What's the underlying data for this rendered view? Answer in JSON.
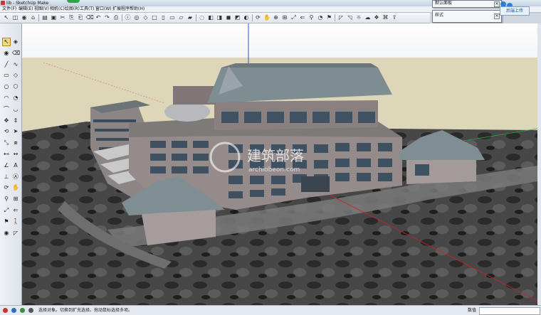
{
  "window": {
    "title": "lib - SketchUp Make",
    "menu": [
      "文件(F)",
      "编辑(E)",
      "视图(V)",
      "相机(C)",
      "绘图(R)",
      "工具(T)",
      "窗口(W)",
      "扩展程序",
      "帮助(H)"
    ]
  },
  "panels": {
    "default_tray": {
      "title": "默认面板",
      "close": "×"
    },
    "styles": {
      "title": "样式",
      "close": "×"
    }
  },
  "login": {
    "label": "后端上传"
  },
  "toolbar_icons": [
    "select-icon",
    "eraser-icon",
    "paint-bucket-icon",
    "house-icon",
    "open-icon",
    "save-icon",
    "cut-icon",
    "copy-icon",
    "paste-icon",
    "erase-icon",
    "undo-icon",
    "redo-icon",
    "print-icon",
    "model-info-icon",
    "camera-icon",
    "iso-view-icon",
    "top-view-icon",
    "front-view-icon",
    "right-view-icon",
    "back-view-icon",
    "left-view-icon",
    "xray-icon",
    "wireframe-icon",
    "hidden-line-icon",
    "shaded-icon",
    "textured-icon",
    "monochrome-icon",
    "orbit-icon",
    "pan-icon",
    "zoom-icon",
    "zoom-window-icon",
    "zoom-extents-icon",
    "previous-view-icon",
    "walk-icon",
    "look-around-icon",
    "position-camera-icon",
    "section-icon",
    "display-section-icon",
    "sun-icon",
    "fog-icon",
    "components-icon",
    "warehouse-icon",
    "share-icon"
  ],
  "left_tools": [
    "select-tool-icon",
    "make-component-icon",
    "paint-bucket-tool-icon",
    "eraser-tool-icon",
    "line-tool-icon",
    "freehand-tool-icon",
    "rectangle-tool-icon",
    "rotated-rectangle-icon",
    "circle-tool-icon",
    "polygon-tool-icon",
    "arc-tool-icon",
    "pie-tool-icon",
    "two-point-arc-icon",
    "three-point-arc-icon",
    "move-tool-icon",
    "push-pull-tool-icon",
    "rotate-tool-icon",
    "follow-me-icon",
    "scale-tool-icon",
    "offset-tool-icon",
    "tape-measure-icon",
    "dimension-tool-icon",
    "protractor-icon",
    "text-tool-icon",
    "axes-tool-icon",
    "3d-text-icon",
    "orbit-tool-icon",
    "pan-tool-icon",
    "zoom-tool-icon",
    "zoom-window-tool-icon",
    "zoom-extents-tool-icon",
    "previous-tool-icon",
    "position-camera-tool-icon",
    "walk-tool-icon",
    "look-around-tool-icon",
    "section-plane-tool-icon"
  ],
  "status": {
    "hint": "选择对象。切换到扩充选择。拖动鼠标选择多项。",
    "measure_label": "数值",
    "measure_value": ""
  },
  "watermark": {
    "text": "建筑部落",
    "sub": "archiobeon.com"
  },
  "colors": {
    "sky": "#ffffff",
    "ground": "#ddd6b9",
    "terrain": "#3b3b3b",
    "roof": "#7d8d92",
    "wall": "#948a8a",
    "red_axis": "#d02020",
    "green_axis": "#20b040",
    "blue_axis": "#3050d0"
  }
}
